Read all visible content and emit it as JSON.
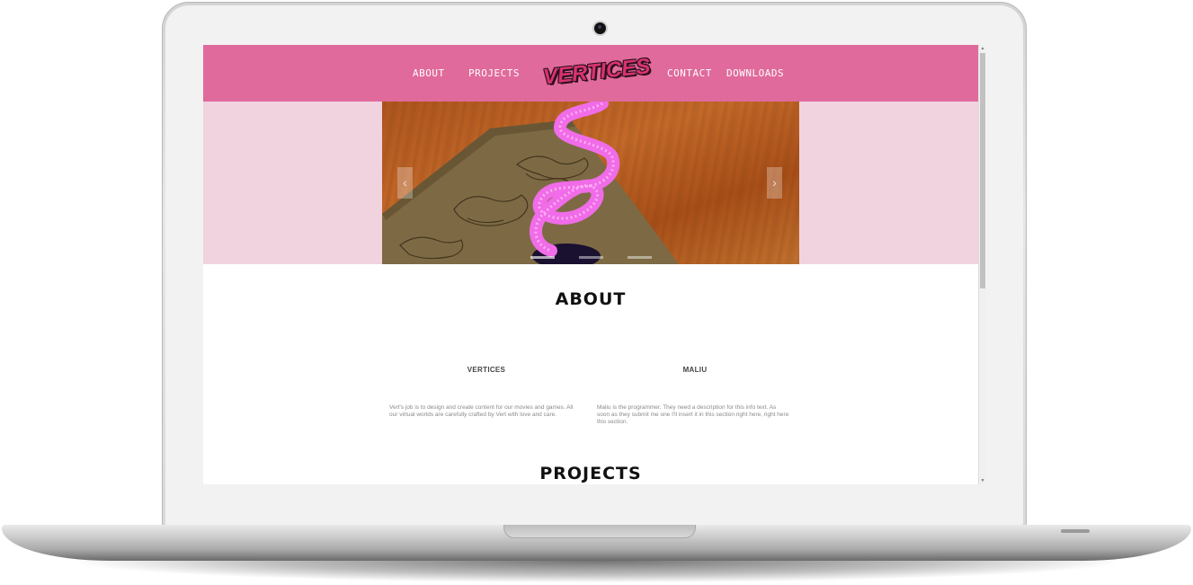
{
  "nav": {
    "about": "ABOUT",
    "projects": "PROJECTS",
    "logo": "VERTICES",
    "contact": "CONTACT",
    "downloads": "DOWNLOADS"
  },
  "carousel": {
    "slide_count": 3,
    "active_slide": 1,
    "prev_glyph": "‹",
    "next_glyph": "›"
  },
  "about": {
    "title": "ABOUT",
    "members": [
      {
        "name": "VERTICES",
        "description": "Vert's job is to design and create content for our movies and games. All our virtual worlds are carefully crafted by Vert with love and care."
      },
      {
        "name": "MALIU",
        "description": "Maliu is the programmer. They need a description for this info text. As soon as they submit me one I'll insert it in this section right here, right here this section."
      }
    ]
  },
  "projects": {
    "title": "PROJECTS"
  },
  "colors": {
    "navbar": "#e06a9b",
    "hero_bg": "#f0d3df",
    "spiral": "#f06ce8",
    "logo": "#d8326d"
  },
  "scrollbar": {
    "up_glyph": "▲",
    "down_glyph": "▼"
  }
}
